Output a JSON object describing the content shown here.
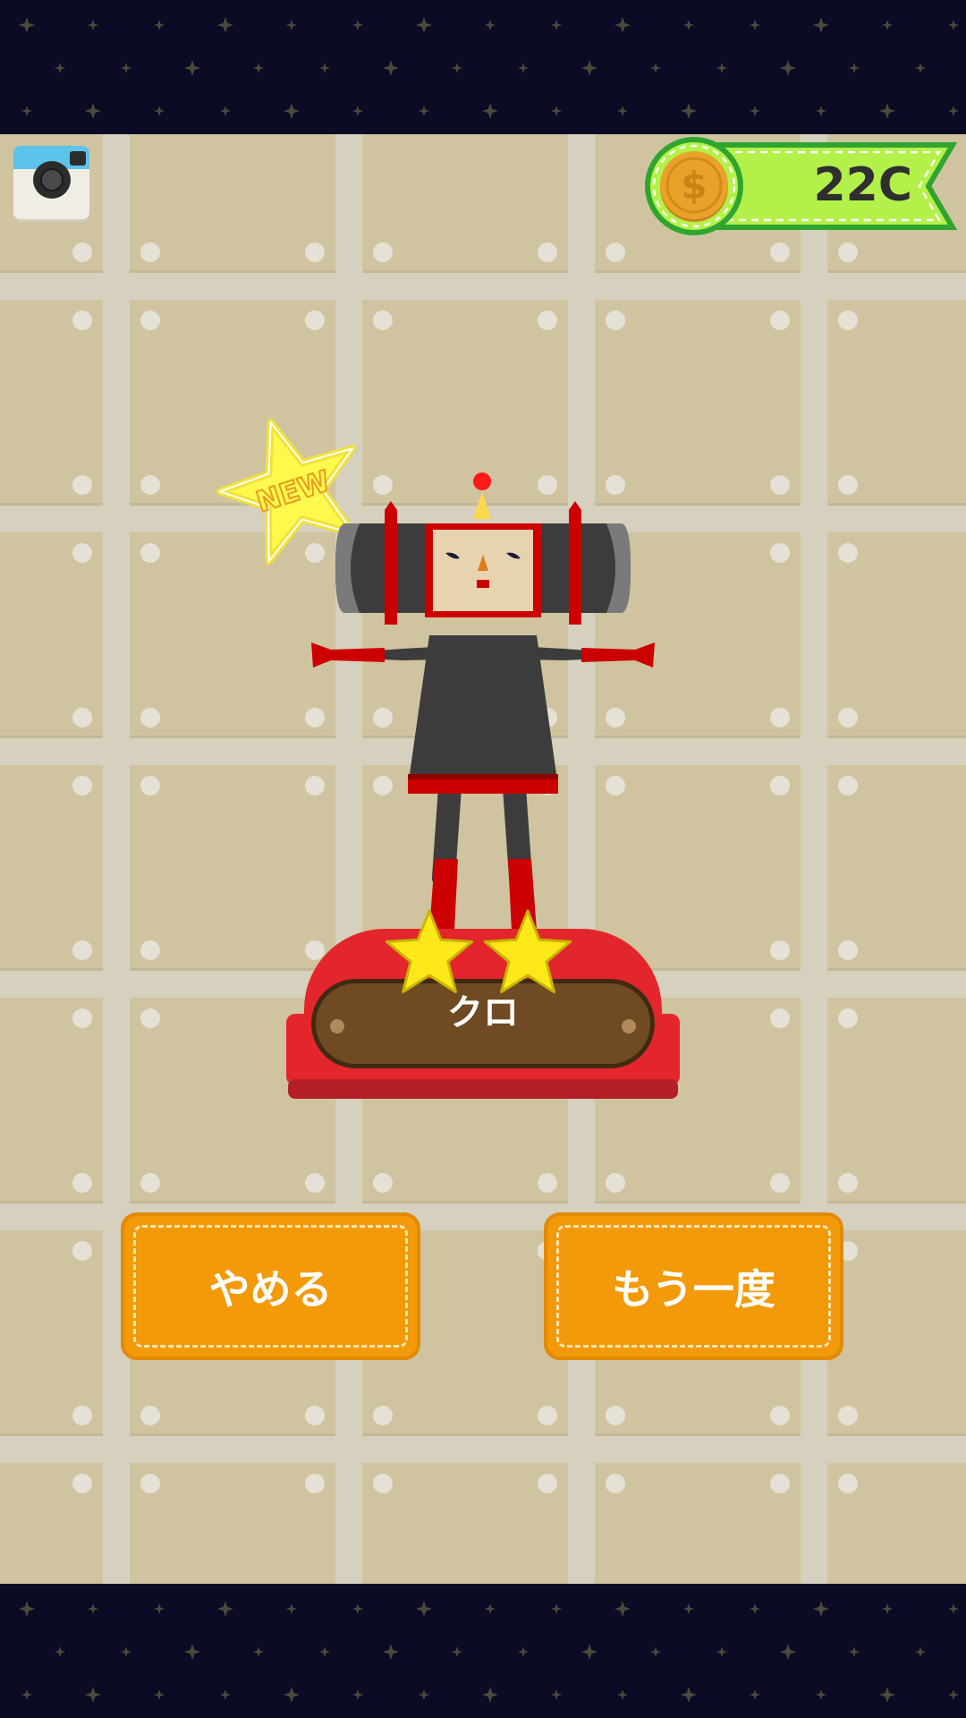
{
  "hud": {
    "camera_icon": "camera-icon",
    "coin_icon": "dollar-coin-icon",
    "coins": "22C",
    "colors": {
      "banner": "#b4f04a",
      "banner_border": "#2fa52f",
      "coin": "#e9a12a"
    }
  },
  "badge": {
    "text": "NEW",
    "color": "#fff84d"
  },
  "character": {
    "name": "クロ",
    "stars": 2,
    "colors": {
      "body": "#3c3c3c",
      "accent": "#cc0000",
      "face": "#e8d3b0"
    }
  },
  "pedestal": {
    "colors": {
      "base": "#e3262b",
      "plaque": "#6f4a22"
    }
  },
  "buttons": {
    "quit": "やめる",
    "retry": "もう一度",
    "color": "#f39a0a"
  }
}
